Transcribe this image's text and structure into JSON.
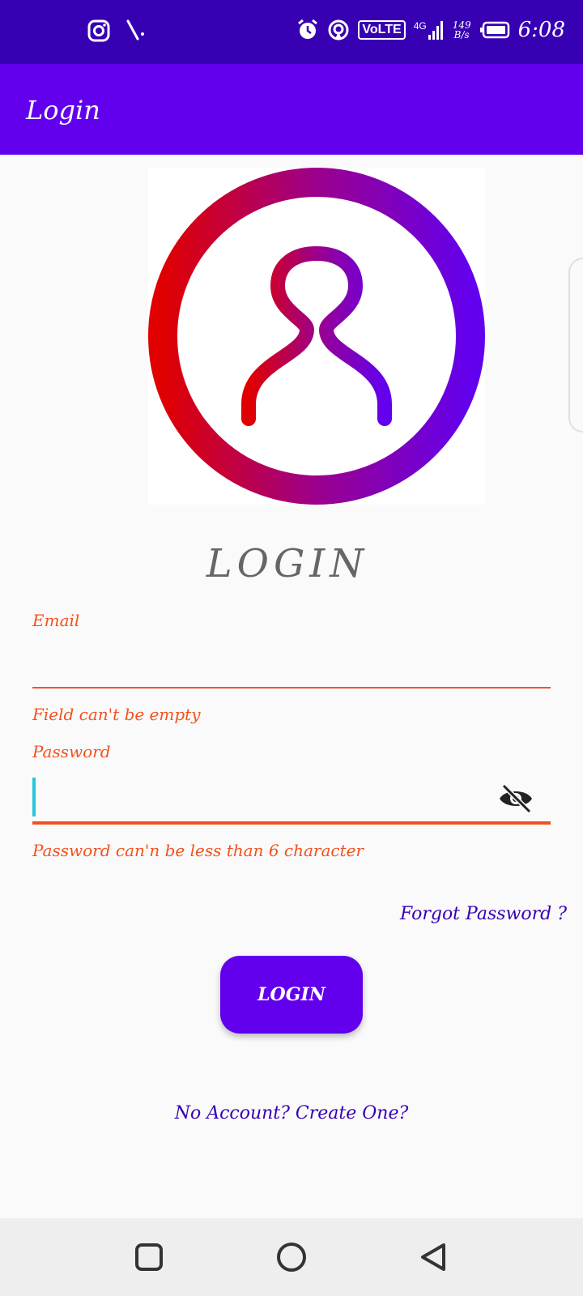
{
  "status_bar": {
    "time": "6:08",
    "network_type": "4G",
    "volte_label": "VoLTE",
    "net_speed_value": "149",
    "net_speed_unit": "B/s",
    "icons": [
      "instagram-icon",
      "notification-icon",
      "alarm-icon",
      "hotspot-icon",
      "signal-icon",
      "battery-icon"
    ]
  },
  "app_bar": {
    "title": "Login"
  },
  "form": {
    "heading": "LOGIN",
    "email": {
      "label": "Email",
      "value": "",
      "error": "Field can't be empty"
    },
    "password": {
      "label": "Password",
      "value": "",
      "error": "Password can'n be less than 6 character"
    },
    "forgot_link": "Forgot Password ?",
    "login_button": "LOGIN",
    "create_account_link": "No Account? Create One?"
  },
  "nav_bar": {
    "icons": [
      "recents-square-icon",
      "home-circle-icon",
      "back-triangle-icon"
    ]
  },
  "colors": {
    "status_bar": "#3700b3",
    "app_bar": "#6200ee",
    "error": "#f4511e",
    "link": "#3700b3",
    "cursor": "#26c6da",
    "avatar_gradient_start": "#e00000",
    "avatar_gradient_end": "#6200ee"
  }
}
